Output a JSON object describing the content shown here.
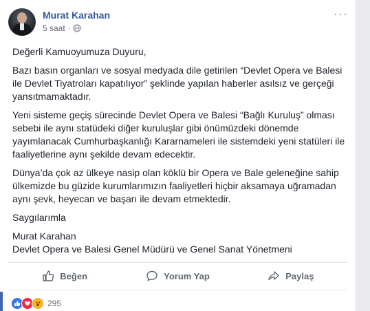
{
  "post": {
    "author": "Murat Karahan",
    "time": "5 saat",
    "separator": "·",
    "paragraphs": [
      "Değerli Kamuoyumuza Duyuru,",
      "Bazı basın organları ve sosyal medyada dile getirilen “Devlet Opera ve Balesi ile Devlet Tiyatroları kapatılıyor” şeklinde yapılan haberler asılsız ve gerçeği yansıtmamaktadır.",
      "Yeni sisteme geçiş sürecinde Devlet Opera ve Balesi “Bağlı Kuruluş” olması sebebi ile aynı statüdeki diğer kuruluşlar gibi önümüzdeki dönemde yayımlanacak Cumhurbaşkanlığı Kararnameleri ile sistemdeki yeni statüleri ile faaliyetlerine aynı şekilde devam edecektir.",
      "Dünya’da çok az ülkeye nasip olan köklü bir Opera ve Bale geleneğine sahip ülkemizde bu güzide kurumlarımızın faaliyetleri hiçbir aksamaya uğramadan aynı şevk, heyecan ve başarı ile devam etmektedir.",
      "Saygılarımla",
      "Murat Karahan",
      "Devlet Opera ve Balesi Genel Müdürü ve Genel Sanat Yönetmeni"
    ]
  },
  "actions": {
    "like": "Beğen",
    "comment": "Yorum Yap",
    "share": "Paylaş"
  },
  "reactions": {
    "count": "295",
    "types": [
      "like",
      "love",
      "wow"
    ]
  },
  "colors": {
    "author_link": "#365899",
    "like_blue": "#3578e5",
    "love_red": "#f0284a",
    "wow_yellow": "#f7b125"
  }
}
